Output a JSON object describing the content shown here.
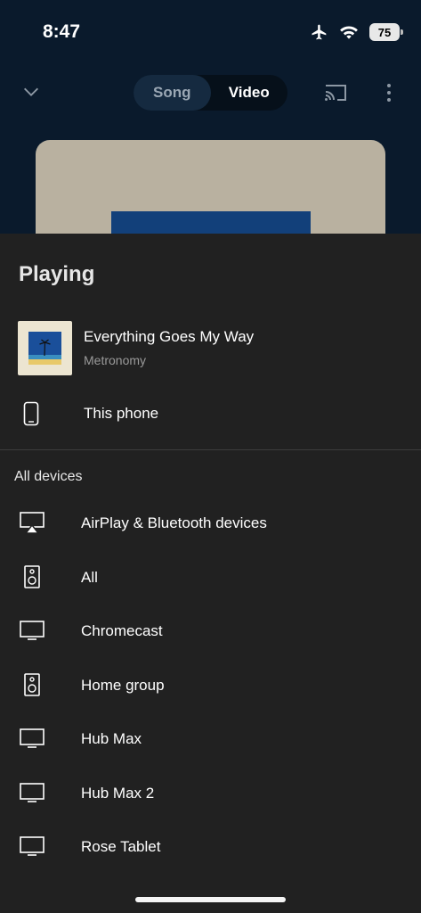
{
  "status_bar": {
    "time": "8:47",
    "battery": "75"
  },
  "player": {
    "tabs": [
      {
        "label": "Song",
        "active": true
      },
      {
        "label": "Video",
        "active": false
      }
    ]
  },
  "sheet": {
    "playing_heading": "Playing",
    "now_playing": {
      "title": "Everything Goes My Way",
      "artist": "Metronomy"
    },
    "this_phone": "This phone",
    "all_devices_heading": "All devices",
    "devices": [
      {
        "label": "AirPlay & Bluetooth devices",
        "icon": "airplay-icon"
      },
      {
        "label": "All",
        "icon": "speaker-icon"
      },
      {
        "label": "Chromecast",
        "icon": "tv-icon"
      },
      {
        "label": "Home group",
        "icon": "speaker-icon"
      },
      {
        "label": "Hub Max",
        "icon": "tv-icon"
      },
      {
        "label": "Hub Max 2",
        "icon": "tv-icon"
      },
      {
        "label": "Rose Tablet",
        "icon": "tv-icon"
      }
    ]
  },
  "colors": {
    "sheet_bg": "#212121",
    "player_bg": "#0a1a2c",
    "accent_toggle": "#152a40"
  }
}
